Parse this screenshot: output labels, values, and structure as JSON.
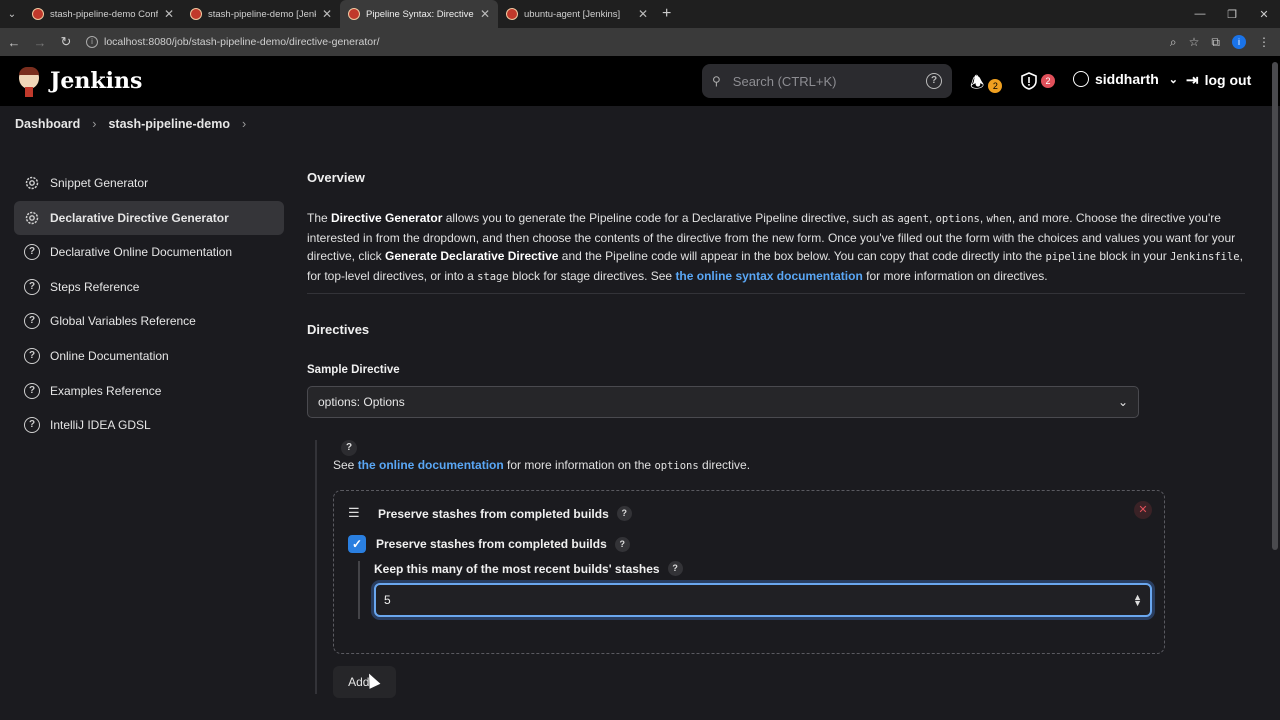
{
  "browser": {
    "tabs": [
      {
        "label": "stash-pipeline-demo Config [Je"
      },
      {
        "label": "stash-pipeline-demo [Jenkins]"
      },
      {
        "label": "Pipeline Syntax: Directive Gene"
      },
      {
        "label": "ubuntu-agent [Jenkins]"
      }
    ],
    "url": "localhost:8080/job/stash-pipeline-demo/directive-generator/"
  },
  "header": {
    "brand": "Jenkins",
    "search_placeholder": "Search (CTRL+K)",
    "notifications_count": "2",
    "security_count": "2",
    "username": "siddharth",
    "logout_label": "log out"
  },
  "breadcrumb": [
    "Dashboard",
    "stash-pipeline-demo"
  ],
  "sidebar": {
    "items": [
      {
        "label": "Snippet Generator",
        "icon": "gear-icon"
      },
      {
        "label": "Declarative Directive Generator",
        "icon": "gear-icon"
      },
      {
        "label": "Declarative Online Documentation",
        "icon": "help-icon"
      },
      {
        "label": "Steps Reference",
        "icon": "help-icon"
      },
      {
        "label": "Global Variables Reference",
        "icon": "help-icon"
      },
      {
        "label": "Online Documentation",
        "icon": "help-icon"
      },
      {
        "label": "Examples Reference",
        "icon": "help-icon"
      },
      {
        "label": "IntelliJ IDEA GDSL",
        "icon": "help-icon"
      }
    ],
    "active_index": 1
  },
  "main": {
    "overview_title": "Overview",
    "overview": {
      "t1": "The ",
      "b1": "Directive Generator",
      "t2": " allows you to generate the Pipeline code for a Declarative Pipeline directive, such as ",
      "c1": "agent",
      "t3": ", ",
      "c2": "options",
      "t4": ", ",
      "c3": "when",
      "t5": ", and more. Choose the directive you're interested in from the dropdown, and then choose the contents of the directive from the new form. Once you've filled out the form with the choices and values you want for your directive, click ",
      "b2": "Generate Declarative Directive",
      "t6": " and the Pipeline code will appear in the box below. You can copy that code directly into the ",
      "c4": "pipeline",
      "t7": " block in your ",
      "c5": "Jenkinsfile",
      "t8": ", for top-level directives, or into a ",
      "c6": "stage",
      "t9": " block for stage directives. See ",
      "link": "the online syntax documentation",
      "t10": " for more information on directives."
    },
    "directives_title": "Directives",
    "sample_label": "Sample Directive",
    "sample_value": "options: Options",
    "help_mark": "?",
    "see_prefix": "See ",
    "see_link": "the online documentation",
    "see_mid": " for more information on the ",
    "see_code": "options",
    "see_suffix": " directive.",
    "card": {
      "title": "Preserve stashes from completed builds",
      "checkbox_label": "Preserve stashes from completed builds",
      "checkbox_checked": true,
      "keep_label": "Keep this many of the most recent builds' stashes",
      "keep_value": "5"
    },
    "add_label": "Add"
  },
  "colors": {
    "accent": "#2a7fe0",
    "link": "#5aa7f5",
    "notif_badge": "#f0a020",
    "security_badge": "#e0505a"
  }
}
